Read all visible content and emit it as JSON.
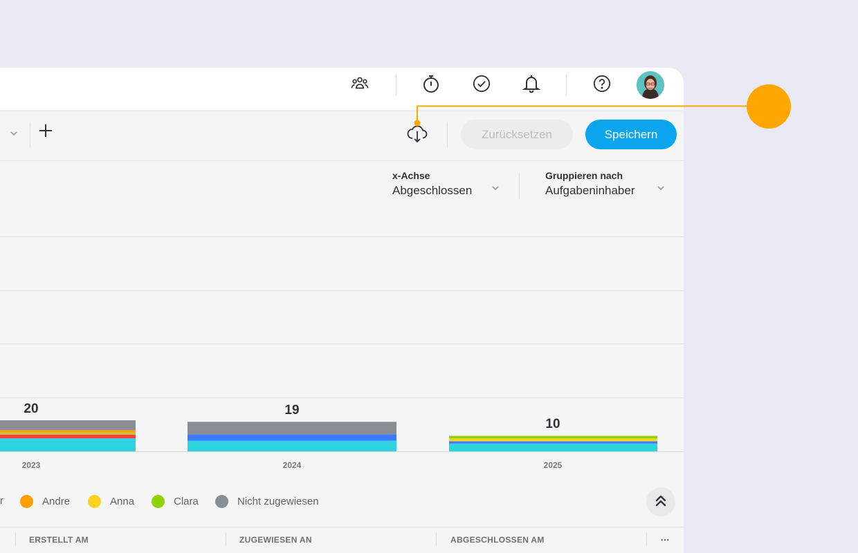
{
  "topbar": {
    "icons": [
      "team-icon",
      "stopwatch-icon",
      "check-circle-icon",
      "bell-icon",
      "help-icon"
    ],
    "avatar": "user-avatar"
  },
  "toolbar": {
    "add_label": "+",
    "reset_label": "Zurücksetzen",
    "save_label": "Speichern",
    "download_icon": "cloud-download-icon"
  },
  "controls": {
    "x_axis": {
      "label": "x-Achse",
      "value": "Abgeschlossen"
    },
    "group_by": {
      "label": "Gruppieren nach",
      "value": "Aufgabeninhaber"
    }
  },
  "chart_data": {
    "type": "bar",
    "stacked": true,
    "categories": [
      "2023",
      "2024",
      "2025"
    ],
    "totals": [
      20,
      19,
      10
    ],
    "series": [
      {
        "name": "Andre",
        "color": "#ff9f00"
      },
      {
        "name": "Anna",
        "color": "#ffd21f"
      },
      {
        "name": "Clara",
        "color": "#8fd400"
      },
      {
        "name": "Nicht zugewiesen",
        "color": "#8a8e94"
      }
    ],
    "legend_partial_left": "r"
  },
  "table": {
    "columns": [
      "ERSTELLT AM",
      "ZUGEWIESEN AN",
      "ABGESCHLOSSEN AM"
    ],
    "more_label": "···"
  },
  "colors": {
    "accent": "#0aa5ee",
    "callout": "#ffa600"
  }
}
